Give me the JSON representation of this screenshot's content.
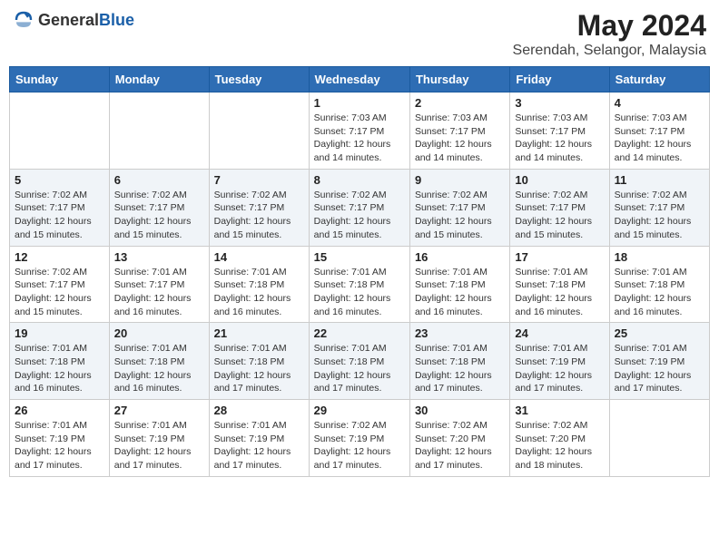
{
  "header": {
    "logo_general": "General",
    "logo_blue": "Blue",
    "month_year": "May 2024",
    "location": "Serendah, Selangor, Malaysia"
  },
  "weekdays": [
    "Sunday",
    "Monday",
    "Tuesday",
    "Wednesday",
    "Thursday",
    "Friday",
    "Saturday"
  ],
  "weeks": [
    [
      {
        "day": "",
        "info": ""
      },
      {
        "day": "",
        "info": ""
      },
      {
        "day": "",
        "info": ""
      },
      {
        "day": "1",
        "info": "Sunrise: 7:03 AM\nSunset: 7:17 PM\nDaylight: 12 hours\nand 14 minutes."
      },
      {
        "day": "2",
        "info": "Sunrise: 7:03 AM\nSunset: 7:17 PM\nDaylight: 12 hours\nand 14 minutes."
      },
      {
        "day": "3",
        "info": "Sunrise: 7:03 AM\nSunset: 7:17 PM\nDaylight: 12 hours\nand 14 minutes."
      },
      {
        "day": "4",
        "info": "Sunrise: 7:03 AM\nSunset: 7:17 PM\nDaylight: 12 hours\nand 14 minutes."
      }
    ],
    [
      {
        "day": "5",
        "info": "Sunrise: 7:02 AM\nSunset: 7:17 PM\nDaylight: 12 hours\nand 15 minutes."
      },
      {
        "day": "6",
        "info": "Sunrise: 7:02 AM\nSunset: 7:17 PM\nDaylight: 12 hours\nand 15 minutes."
      },
      {
        "day": "7",
        "info": "Sunrise: 7:02 AM\nSunset: 7:17 PM\nDaylight: 12 hours\nand 15 minutes."
      },
      {
        "day": "8",
        "info": "Sunrise: 7:02 AM\nSunset: 7:17 PM\nDaylight: 12 hours\nand 15 minutes."
      },
      {
        "day": "9",
        "info": "Sunrise: 7:02 AM\nSunset: 7:17 PM\nDaylight: 12 hours\nand 15 minutes."
      },
      {
        "day": "10",
        "info": "Sunrise: 7:02 AM\nSunset: 7:17 PM\nDaylight: 12 hours\nand 15 minutes."
      },
      {
        "day": "11",
        "info": "Sunrise: 7:02 AM\nSunset: 7:17 PM\nDaylight: 12 hours\nand 15 minutes."
      }
    ],
    [
      {
        "day": "12",
        "info": "Sunrise: 7:02 AM\nSunset: 7:17 PM\nDaylight: 12 hours\nand 15 minutes."
      },
      {
        "day": "13",
        "info": "Sunrise: 7:01 AM\nSunset: 7:17 PM\nDaylight: 12 hours\nand 16 minutes."
      },
      {
        "day": "14",
        "info": "Sunrise: 7:01 AM\nSunset: 7:18 PM\nDaylight: 12 hours\nand 16 minutes."
      },
      {
        "day": "15",
        "info": "Sunrise: 7:01 AM\nSunset: 7:18 PM\nDaylight: 12 hours\nand 16 minutes."
      },
      {
        "day": "16",
        "info": "Sunrise: 7:01 AM\nSunset: 7:18 PM\nDaylight: 12 hours\nand 16 minutes."
      },
      {
        "day": "17",
        "info": "Sunrise: 7:01 AM\nSunset: 7:18 PM\nDaylight: 12 hours\nand 16 minutes."
      },
      {
        "day": "18",
        "info": "Sunrise: 7:01 AM\nSunset: 7:18 PM\nDaylight: 12 hours\nand 16 minutes."
      }
    ],
    [
      {
        "day": "19",
        "info": "Sunrise: 7:01 AM\nSunset: 7:18 PM\nDaylight: 12 hours\nand 16 minutes."
      },
      {
        "day": "20",
        "info": "Sunrise: 7:01 AM\nSunset: 7:18 PM\nDaylight: 12 hours\nand 16 minutes."
      },
      {
        "day": "21",
        "info": "Sunrise: 7:01 AM\nSunset: 7:18 PM\nDaylight: 12 hours\nand 17 minutes."
      },
      {
        "day": "22",
        "info": "Sunrise: 7:01 AM\nSunset: 7:18 PM\nDaylight: 12 hours\nand 17 minutes."
      },
      {
        "day": "23",
        "info": "Sunrise: 7:01 AM\nSunset: 7:18 PM\nDaylight: 12 hours\nand 17 minutes."
      },
      {
        "day": "24",
        "info": "Sunrise: 7:01 AM\nSunset: 7:19 PM\nDaylight: 12 hours\nand 17 minutes."
      },
      {
        "day": "25",
        "info": "Sunrise: 7:01 AM\nSunset: 7:19 PM\nDaylight: 12 hours\nand 17 minutes."
      }
    ],
    [
      {
        "day": "26",
        "info": "Sunrise: 7:01 AM\nSunset: 7:19 PM\nDaylight: 12 hours\nand 17 minutes."
      },
      {
        "day": "27",
        "info": "Sunrise: 7:01 AM\nSunset: 7:19 PM\nDaylight: 12 hours\nand 17 minutes."
      },
      {
        "day": "28",
        "info": "Sunrise: 7:01 AM\nSunset: 7:19 PM\nDaylight: 12 hours\nand 17 minutes."
      },
      {
        "day": "29",
        "info": "Sunrise: 7:02 AM\nSunset: 7:19 PM\nDaylight: 12 hours\nand 17 minutes."
      },
      {
        "day": "30",
        "info": "Sunrise: 7:02 AM\nSunset: 7:20 PM\nDaylight: 12 hours\nand 17 minutes."
      },
      {
        "day": "31",
        "info": "Sunrise: 7:02 AM\nSunset: 7:20 PM\nDaylight: 12 hours\nand 18 minutes."
      },
      {
        "day": "",
        "info": ""
      }
    ]
  ]
}
